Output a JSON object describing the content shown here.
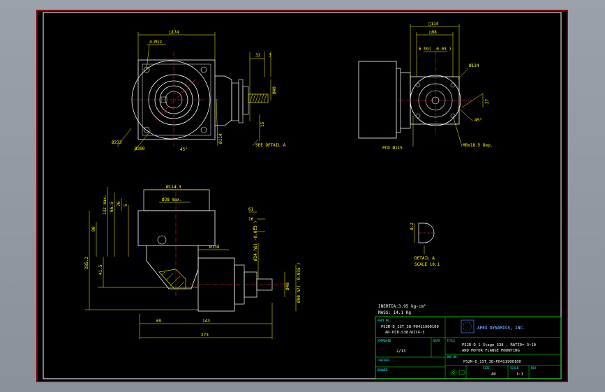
{
  "colors": {
    "background": "#000000",
    "frame": "#ff0000",
    "border": "#ffffff",
    "outline": "#ffffff",
    "dimension": "#ffff00",
    "centerline": "#ff3030",
    "hatch": "#ffff00",
    "title_block": "#00ff00",
    "company": "#4f8cff"
  },
  "views": {
    "front": {
      "dim_square": "□174",
      "dim_holes": "4-M12",
      "dim_d233": "Ø233",
      "dim_d200": "Ø200",
      "dim_d114": "Ø114",
      "dim_angle": "45°",
      "see_detail": "SEE DETAIL A",
      "dim_32": "32",
      "dim_3": "3",
      "dim_w": "Ø40",
      "dim_15": "15"
    },
    "side": {
      "dim_sq114": "□114",
      "dim_sq98": "□98",
      "dim_key": "6 h9( -0.03 )",
      "dim_d134": "Ø134",
      "dim_27": "27",
      "dim_45": "45°",
      "pcd": "PCD Ø115",
      "holes": "M8x18.5 Dep."
    },
    "section": {
      "dim_d114_3": "Ø114.3",
      "dim_d38": "Ø38 max.",
      "dim_132": "132 max.",
      "dim_665": "66.5",
      "dim_76": "76",
      "dim_5": "5",
      "dim_90": "90",
      "dim_2852": "285.2",
      "dim_415": "41.5",
      "dim_d138": "Ø138",
      "dim_61": "61",
      "dim_16": "16",
      "dim_5b": "5",
      "dim_d24": "Ø24 h6( -0.013 )",
      "dim_d40": "Ø40",
      "dim_d90": "Ø90 h7( -0.035 )",
      "dim_69": "69",
      "dim_143": "143",
      "dim_273": "273"
    },
    "detail": {
      "dim_82": "8.2",
      "label": "DETAIL A",
      "scale": "SCALE 10:1"
    }
  },
  "notes": {
    "inertia": "INERTIA:3.95 kg-cm²",
    "mass": "MASS: 14.1 Kg"
  },
  "title_block": {
    "part_no_label": "PART NO.",
    "part_no": "PS2R-D_1ST_38-P0411900100",
    "part_no_2": "AD-PCB-S38-W174-3",
    "company": "APEX DYNAMICS, INC.",
    "approved_label": "APPROVED",
    "approved": "2/13",
    "date_label": "DATE",
    "checked_label": "CHECKED",
    "drawn_label": "DRAWER",
    "title_label": "TITLE",
    "title_1": "PS2R-D_1 Stage_S38 , RATIO= 3~10",
    "title_2": "AND MOTOR FLANGE MOUNTING",
    "dwg_label": "DWG NO.",
    "dwg_no": "PS2R-D_1ST_38-P0411900100",
    "size_label": "SIZE",
    "size": "A0",
    "scale_label": "SCALE",
    "scale": "1:1",
    "rev_label": "REV"
  }
}
